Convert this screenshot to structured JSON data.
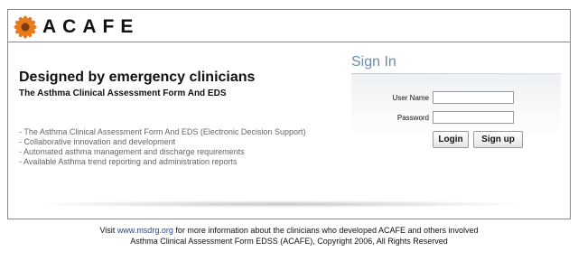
{
  "brand": {
    "name": "ACAFE"
  },
  "intro": {
    "tagline": "Designed by emergency clinicians",
    "subtitle": "The Asthma Clinical Assessment Form And EDS",
    "features": [
      "- The Asthma Clinical Assessment Form And EDS (Electronic Decision Support)",
      "- Collaborative innovation and development",
      "- Automated asthma management and discharge requirements",
      "- Available Asthma trend reporting and administration reports"
    ]
  },
  "signin": {
    "title": "Sign In",
    "username_label": "User Name",
    "username_value": "",
    "password_label": "Password",
    "password_value": "",
    "login_label": "Login",
    "signup_label": "Sign up"
  },
  "footer": {
    "line1_prefix": "Visit ",
    "link_text": "www.msdrg.org",
    "line1_suffix": " for more information about the clinicians who developed ACAFE and others involved",
    "line2": "Asthma Clinical Assessment Form EDSS (ACAFE), Copyright 2006, All Rights Reserved"
  },
  "colors": {
    "signin_title": "#6d8eb4",
    "link": "#2244aa",
    "logo_petal": "#e87a1e"
  }
}
